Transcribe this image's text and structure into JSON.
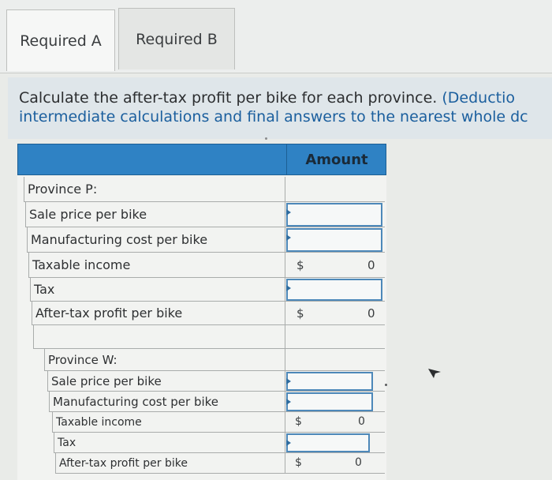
{
  "tabs": [
    {
      "label": "Required A"
    },
    {
      "label": "Required B"
    }
  ],
  "instructions": {
    "line1_plain": "Calculate the after-tax profit per bike for each province. ",
    "line1_highlight": "(Deductio",
    "line2_highlight": "intermediate calculations and final answers to the nearest whole dc"
  },
  "table": {
    "header_amount": "Amount",
    "province_p": {
      "title": "Province P:",
      "rows": [
        {
          "label": "Sale price per bike",
          "value": ""
        },
        {
          "label": "Manufacturing cost per bike",
          "value": ""
        },
        {
          "label": "Taxable income",
          "currency": "$",
          "value": "0"
        },
        {
          "label": "Tax",
          "value": ""
        },
        {
          "label": "After-tax profit per bike",
          "currency": "$",
          "value": "0"
        }
      ]
    },
    "province_w": {
      "title": "Province W:",
      "rows": [
        {
          "label": "Sale price per bike",
          "value": ""
        },
        {
          "label": "Manufacturing cost per bike",
          "value": ""
        },
        {
          "label": "Taxable income",
          "currency": "$",
          "value": "0"
        },
        {
          "label": "Tax",
          "value": ""
        },
        {
          "label": "After-tax profit per bike",
          "currency": "$",
          "value": "0"
        }
      ]
    }
  },
  "icons": {
    "cursor": "mouse-pointer-icon"
  }
}
